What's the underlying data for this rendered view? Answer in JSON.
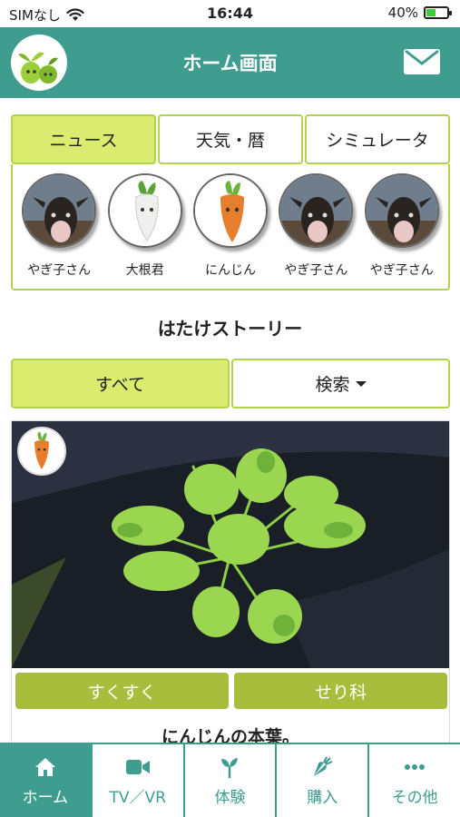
{
  "status_bar": {
    "carrier": "SIMなし",
    "time": "16:44",
    "battery_percent": "40%",
    "battery_level": 0.4
  },
  "header": {
    "title": "ホーム画面",
    "logo_icon": "sprout-logo-icon",
    "mail_icon": "mail-icon"
  },
  "top_tabs": [
    {
      "label": "ニュース",
      "active": true
    },
    {
      "label": "天気・暦",
      "active": false
    },
    {
      "label": "シミュレータ",
      "active": false
    }
  ],
  "characters": [
    {
      "name": "やぎ子さん",
      "icon": "goat-avatar-icon"
    },
    {
      "name": "大根君",
      "icon": "daikon-avatar-icon"
    },
    {
      "name": "にんじん",
      "icon": "carrot-avatar-icon"
    },
    {
      "name": "やぎ子さん",
      "icon": "goat-avatar-icon"
    },
    {
      "name": "やぎ子さん",
      "icon": "goat-avatar-icon"
    }
  ],
  "section_title": "はたけストーリー",
  "filter_tabs": [
    {
      "label": "すべて",
      "active": true
    },
    {
      "label": "検索",
      "active": false,
      "dropdown": true
    }
  ],
  "story": {
    "tags": [
      "すくすく",
      "せり科"
    ],
    "caption": "にんじんの本葉。",
    "avatar_icon": "carrot-avatar-icon"
  },
  "bottom_nav": [
    {
      "label": "ホーム",
      "icon": "home-icon",
      "active": true
    },
    {
      "label": "TV／VR",
      "icon": "video-camera-icon",
      "active": false
    },
    {
      "label": "体験",
      "icon": "sprout-icon",
      "active": false
    },
    {
      "label": "購入",
      "icon": "carrot-icon",
      "active": false
    },
    {
      "label": "その他",
      "icon": "more-dots-icon",
      "active": false
    }
  ],
  "colors": {
    "header": "#3e9d8f",
    "tab_active": "#d9ec6f",
    "tab_border": "#b2d34a",
    "tag": "#a9bd3c"
  }
}
